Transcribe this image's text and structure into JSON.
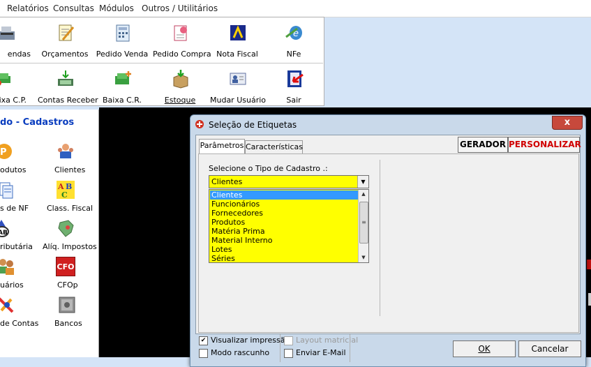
{
  "menu": [
    "Relatórios",
    "Consultas",
    "Módulos",
    "Outros / Utilitários"
  ],
  "toolbar": {
    "row1": [
      "endas",
      "Orçamentos",
      "Pedido Venda",
      "Pedido Compra",
      "Nota Fiscal",
      "NFe"
    ],
    "row2": [
      "ixa C.P.",
      "Contas Receber",
      "Baixa C.R.",
      "Estoque",
      "Mudar Usuário",
      "Sair"
    ]
  },
  "side": {
    "title": "do - Cadastros",
    "items": [
      "odutos",
      "Clientes",
      "s de NF",
      "Class. Fiscal",
      "ributária",
      "Alíq. Impostos",
      "uários",
      "CFOp",
      "de Contas",
      "Bancos"
    ],
    "cfo_icon_text": "CFO"
  },
  "dialog": {
    "title": "Seleção de Etiquetas",
    "close": "x",
    "tabs": [
      "Parâmetros",
      "Características"
    ],
    "gerador": "GERADOR",
    "personalizar": "PERSONALIZAR",
    "label": "Selecione o Tipo de Cadastro .:",
    "selected": "Clientes",
    "options": [
      "Clientes",
      "Funcionários",
      "Fornecedores",
      "Produtos",
      "Matéria Prima",
      "Material Interno",
      "Lotes",
      "Séries"
    ],
    "checks": {
      "visualizar": "Visualizar impressão",
      "rascunho": "Modo rascunho",
      "layout": "Layout matricial",
      "email": "Enviar E-Mail"
    },
    "ok": "OK",
    "cancel": "Cancelar"
  },
  "colors": {
    "accent": "#0a3dbf",
    "highlight": "#ffff00",
    "selection": "#3399ff",
    "danger": "#d00000"
  }
}
